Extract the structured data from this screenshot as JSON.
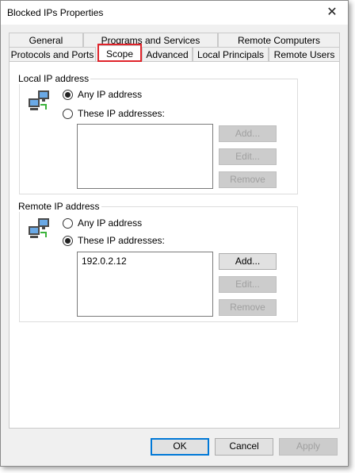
{
  "window": {
    "title": "Blocked IPs Properties"
  },
  "tabs_row1": [
    {
      "label": "General"
    },
    {
      "label": "Programs and Services"
    },
    {
      "label": "Remote Computers"
    }
  ],
  "tabs_row2": [
    {
      "label": "Protocols and Ports"
    },
    {
      "label": "Scope"
    },
    {
      "label": "Advanced"
    },
    {
      "label": "Local Principals"
    },
    {
      "label": "Remote Users"
    }
  ],
  "local": {
    "title": "Local IP address",
    "any_label": "Any IP address",
    "these_label": "These IP addresses:",
    "selected": "any",
    "items": [],
    "add_label": "Add...",
    "edit_label": "Edit...",
    "remove_label": "Remove"
  },
  "remote": {
    "title": "Remote IP address",
    "any_label": "Any IP address",
    "these_label": "These IP addresses:",
    "selected": "these",
    "items": [
      "192.0.2.12"
    ],
    "add_label": "Add...",
    "edit_label": "Edit...",
    "remove_label": "Remove"
  },
  "footer": {
    "ok_label": "OK",
    "cancel_label": "Cancel",
    "apply_label": "Apply"
  },
  "colors": {
    "highlight": "#e0242b",
    "accent": "#0078d7"
  },
  "icons": {
    "close": "close-icon",
    "network": "network-computers-icon"
  }
}
